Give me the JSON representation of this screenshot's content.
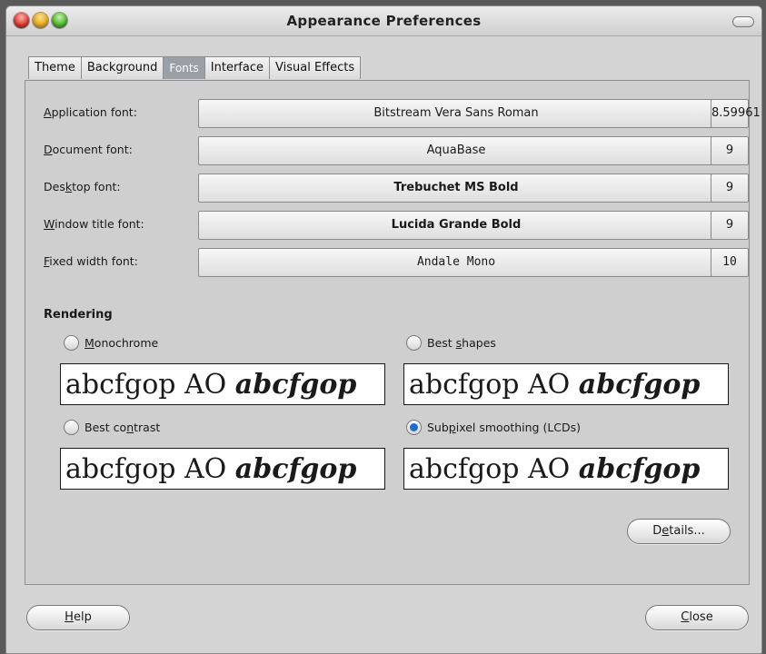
{
  "window": {
    "title": "Appearance Preferences"
  },
  "tabs": [
    "Theme",
    "Background",
    "Fonts",
    "Interface",
    "Visual Effects"
  ],
  "active_tab": "Fonts",
  "fonts": [
    {
      "label_pre": "",
      "label_key": "A",
      "label_post": "pplication font:",
      "font": "Bitstream Vera Sans Roman",
      "size": "8.59961"
    },
    {
      "label_pre": "",
      "label_key": "D",
      "label_post": "ocument font:",
      "font": "AquaBase",
      "size": "9"
    },
    {
      "label_pre": "Des",
      "label_key": "k",
      "label_post": "top font:",
      "font": "Trebuchet MS Bold",
      "size": "9"
    },
    {
      "label_pre": "",
      "label_key": "W",
      "label_post": "indow title font:",
      "font": "Lucida Grande Bold",
      "size": "9"
    },
    {
      "label_pre": "",
      "label_key": "F",
      "label_post": "ixed width font:",
      "font": "Andale Mono",
      "size": "10"
    }
  ],
  "rendering": {
    "heading": "Rendering",
    "sample_regular": "abcfgop AO ",
    "sample_italic": "abcfgop",
    "options": [
      {
        "pre": "",
        "key": "M",
        "post": "onochrome",
        "selected": false
      },
      {
        "pre": "Best ",
        "key": "s",
        "post": "hapes",
        "selected": false
      },
      {
        "pre": "Best co",
        "key": "n",
        "post": "trast",
        "selected": false
      },
      {
        "pre": "Sub",
        "key": "p",
        "post": "ixel smoothing (LCDs)",
        "selected": true
      }
    ]
  },
  "buttons": {
    "details": {
      "pre": "D",
      "key": "e",
      "post": "tails..."
    },
    "help": {
      "pre": "",
      "key": "H",
      "post": "elp"
    },
    "close": {
      "pre": "",
      "key": "C",
      "post": "lose"
    }
  },
  "colors": {
    "accent": "#1c6fd0",
    "active_tab": "#9aa0a6"
  }
}
